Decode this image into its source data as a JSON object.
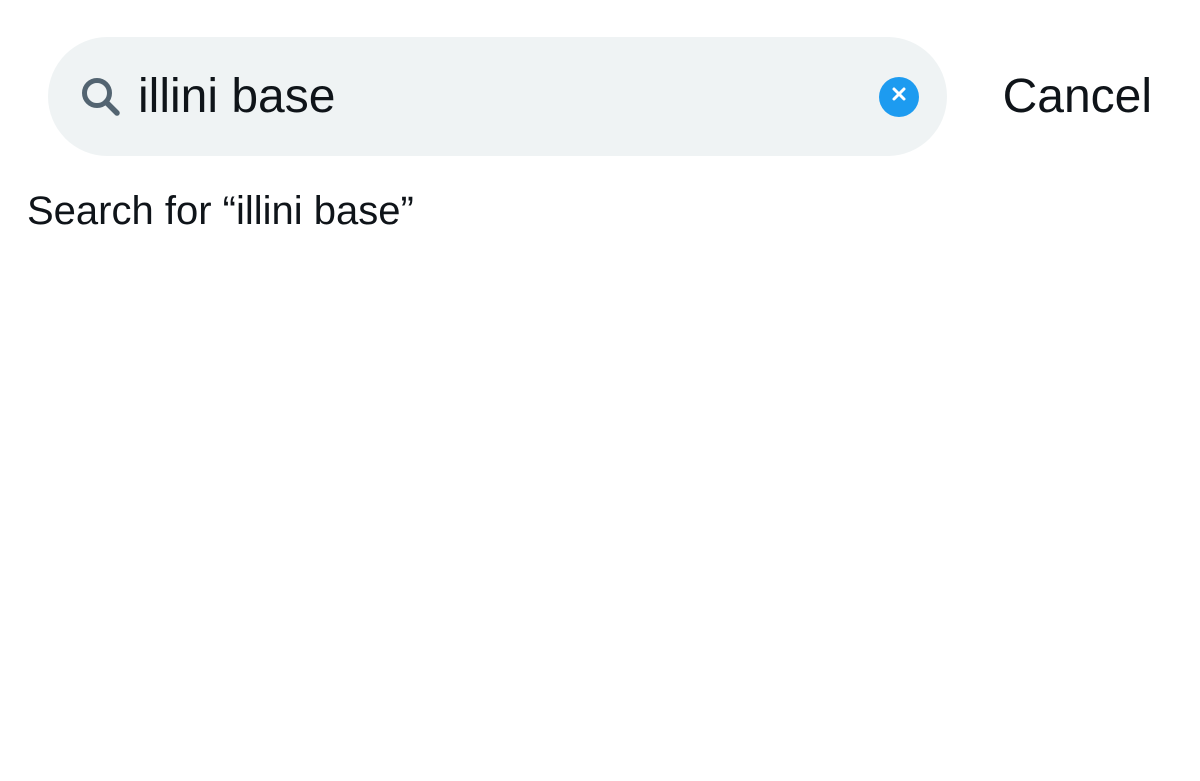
{
  "search": {
    "value": "illini base",
    "icon": "search-icon",
    "clear_icon": "close-icon",
    "accent_color": "#1d9bf0",
    "field_background": "#eff3f4"
  },
  "cancel_label": "Cancel",
  "suggestion": {
    "text": "Search for “illini base”"
  }
}
